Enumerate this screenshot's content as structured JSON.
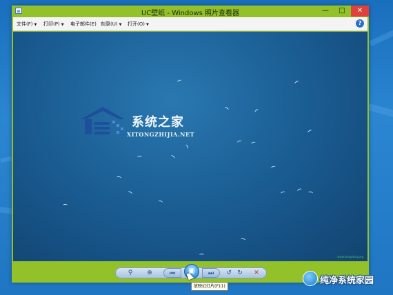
{
  "window": {
    "title": "UC壁纸 - Windows 照片查看器",
    "minimize_glyph": "—",
    "maximize_glyph": "□",
    "close_glyph": "✕"
  },
  "menu": {
    "items": [
      {
        "label": "文件(F)",
        "caret": "▼"
      },
      {
        "label": "打印(P)",
        "caret": "▼"
      },
      {
        "label": "电子邮件(E)"
      },
      {
        "label": "刻录(U)",
        "caret": "▼"
      },
      {
        "label": "打开(O)",
        "caret": "▼"
      }
    ],
    "help_glyph": "?"
  },
  "image": {
    "watermark_title": "系统之家",
    "watermark_subtitle": "XITONGZHIJIA.NET",
    "corner_url": "www.ilongstory.org"
  },
  "controls": {
    "zoom_glyph": "⚲",
    "fit_glyph": "⊕",
    "prev_glyph": "⏮",
    "slideshow_glyph": "▣",
    "next_glyph": "⏭",
    "rotate_ccw_glyph": "↺",
    "rotate_cw_glyph": "↻",
    "delete_glyph": "✕",
    "tooltip": "放映幻灯片(F11)"
  },
  "branding": {
    "site_name": "纯净系统家园"
  },
  "colors": {
    "window_frame": "#93c12a",
    "close_button": "#e0413b",
    "desktop": "#1f76c3"
  }
}
